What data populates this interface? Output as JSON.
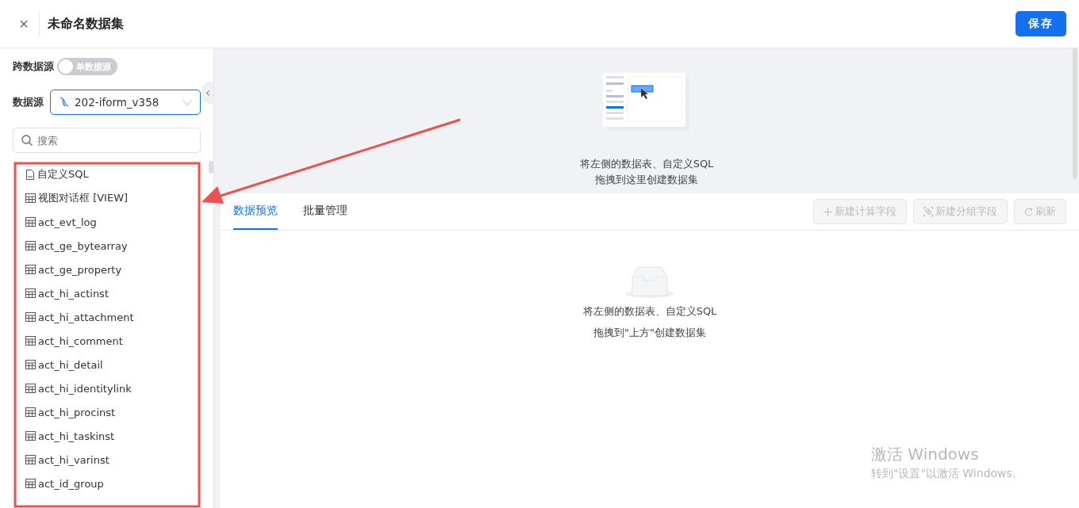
{
  "header": {
    "close_icon": "×",
    "title": "未命名数据集",
    "save_button": "保存"
  },
  "sidebar": {
    "cross_source": {
      "label": "跨数据源",
      "toggle_text": "单数据源",
      "on": false
    },
    "datasource": {
      "label": "数据源",
      "value": "202-iform_v358"
    },
    "search": {
      "placeholder": "搜索"
    },
    "items": [
      {
        "kind": "sql",
        "label": "自定义SQL"
      },
      {
        "kind": "table",
        "label": "视图对话框 [VIEW]"
      },
      {
        "kind": "table",
        "label": "act_evt_log"
      },
      {
        "kind": "table",
        "label": "act_ge_bytearray"
      },
      {
        "kind": "table",
        "label": "act_ge_property"
      },
      {
        "kind": "table",
        "label": "act_hi_actinst"
      },
      {
        "kind": "table",
        "label": "act_hi_attachment"
      },
      {
        "kind": "table",
        "label": "act_hi_comment"
      },
      {
        "kind": "table",
        "label": "act_hi_detail"
      },
      {
        "kind": "table",
        "label": "act_hi_identitylink"
      },
      {
        "kind": "table",
        "label": "act_hi_procinst"
      },
      {
        "kind": "table",
        "label": "act_hi_taskinst"
      },
      {
        "kind": "table",
        "label": "act_hi_varinst"
      },
      {
        "kind": "table",
        "label": "act_id_group"
      }
    ]
  },
  "canvas": {
    "hint_lines": [
      "将左侧的数据表、自定义SQL",
      "拖拽到这里创建数据集"
    ]
  },
  "preview": {
    "tabs": [
      {
        "label": "数据预览",
        "selected": true
      },
      {
        "label": "批量管理",
        "selected": false
      }
    ],
    "buttons": [
      {
        "kind": "plus",
        "label": "新建计算字段",
        "disabled": true
      },
      {
        "kind": "group",
        "label": "新建分组字段",
        "disabled": true
      },
      {
        "kind": "refresh",
        "label": "刷新",
        "disabled": true
      }
    ],
    "empty_lines": [
      "将左侧的数据表、自定义SQL",
      "拖拽到\"上方\"创建数据集"
    ]
  },
  "os_notice": {
    "title": "激活 Windows",
    "text": "转到\"设置\"以激活 Windows。"
  }
}
